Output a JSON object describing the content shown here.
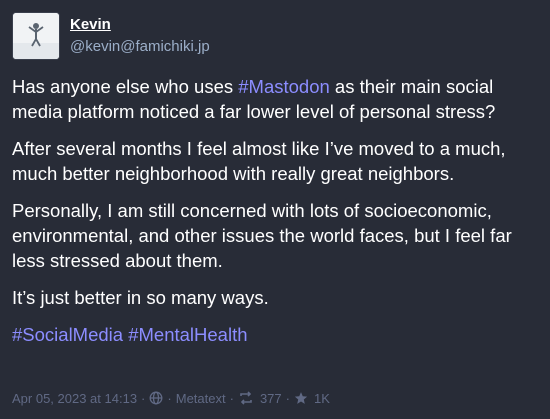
{
  "author": {
    "display_name": "Kevin",
    "handle": "@kevin@famichiki.jp"
  },
  "post": {
    "p1_prefix": "Has anyone else who uses ",
    "p1_hashtag": "#Mastodon",
    "p1_suffix": " as their main social media platform noticed a far lower level of personal stress?",
    "p2": "After several months I feel almost like I’ve moved to a much, much better neighborhood with really great neighbors.",
    "p3": "Personally, I am still concerned with lots of socioeconomic, environmental, and other issues the world faces, but I feel far less stressed about them.",
    "p4": "It’s just better in so many ways.",
    "hashtag_a": "#SocialMedia",
    "hashtag_b": "#MentalHealth"
  },
  "meta": {
    "timestamp": "Apr 05, 2023 at 14:13",
    "separator": "·",
    "visibility_icon": "globe-icon",
    "application": "Metatext",
    "boost_icon": "boost-icon",
    "boost_count": "377",
    "favourite_icon": "star-icon",
    "favourite_count": "1K"
  },
  "colors": {
    "background": "#282c37",
    "text": "#ffffff",
    "muted": "#9baec8",
    "footer": "#606984",
    "hashtag": "#8c8dff"
  }
}
